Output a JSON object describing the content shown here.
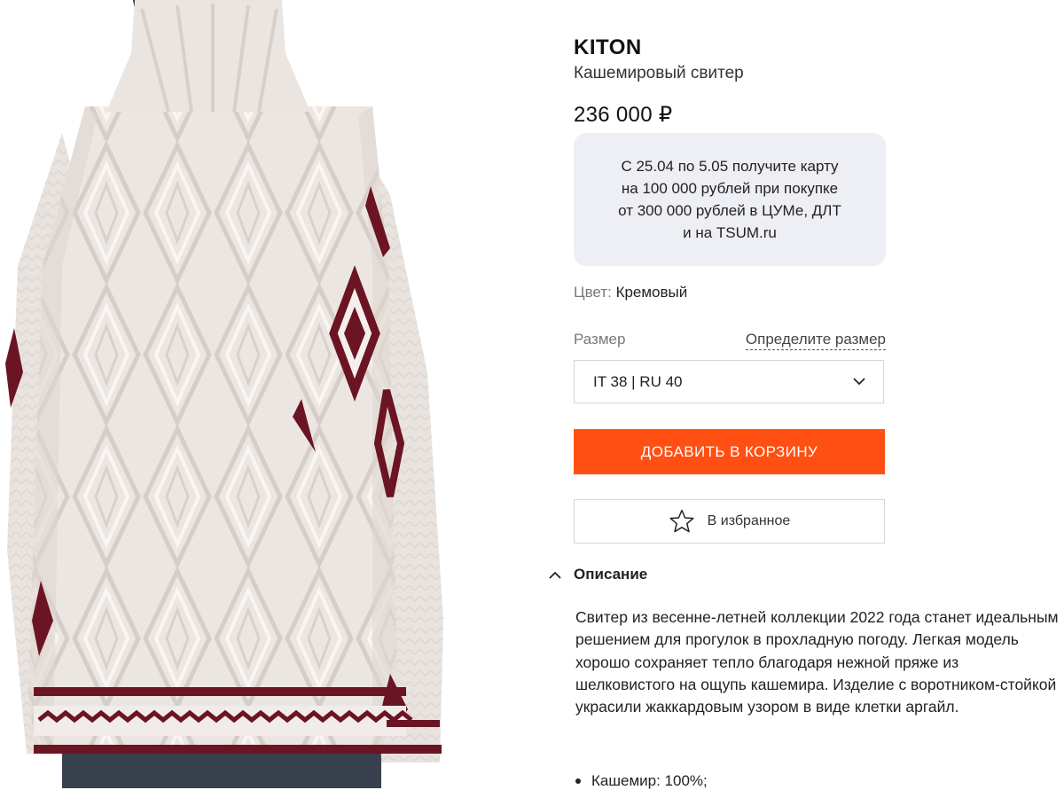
{
  "product": {
    "brand": "KITON",
    "name": "Кашемировый свитер",
    "price": "236 000 ₽"
  },
  "promo": {
    "text": "С 25.04 по 5.05 получите карту\nна 100 000 рублей при покупке\nот 300 000 рублей в ЦУМе, ДЛТ\nи на TSUM.ru"
  },
  "color": {
    "label": "Цвет:",
    "value": "Кремовый"
  },
  "size": {
    "label": "Размер",
    "guide_link": "Определите размер",
    "selected": "IT 38 | RU 40"
  },
  "actions": {
    "add_to_cart": "Добавить в корзину",
    "favorite": "В избранное"
  },
  "description": {
    "title": "Описание",
    "text": "Свитер из весенне-летней коллекции 2022 года станет идеальным решением для прогулок в прохладную погоду. Легкая модель хорошо сохраняет тепло благодаря нежной пряже из шелковистого на ощупь кашемира. Изделие с воротником-стойкой украсили жаккардовым узором в виде клетки аргайл.",
    "composition": "Кашемир: 100%;"
  },
  "colors": {
    "accent": "#ff4f12",
    "promo_bg": "#eeeff4",
    "sweater": "#efeae6",
    "motif": "#6b1424"
  },
  "icons": {
    "size_select": "chevron-down-icon",
    "favorite": "star-icon",
    "description_toggle": "chevron-up-icon"
  }
}
